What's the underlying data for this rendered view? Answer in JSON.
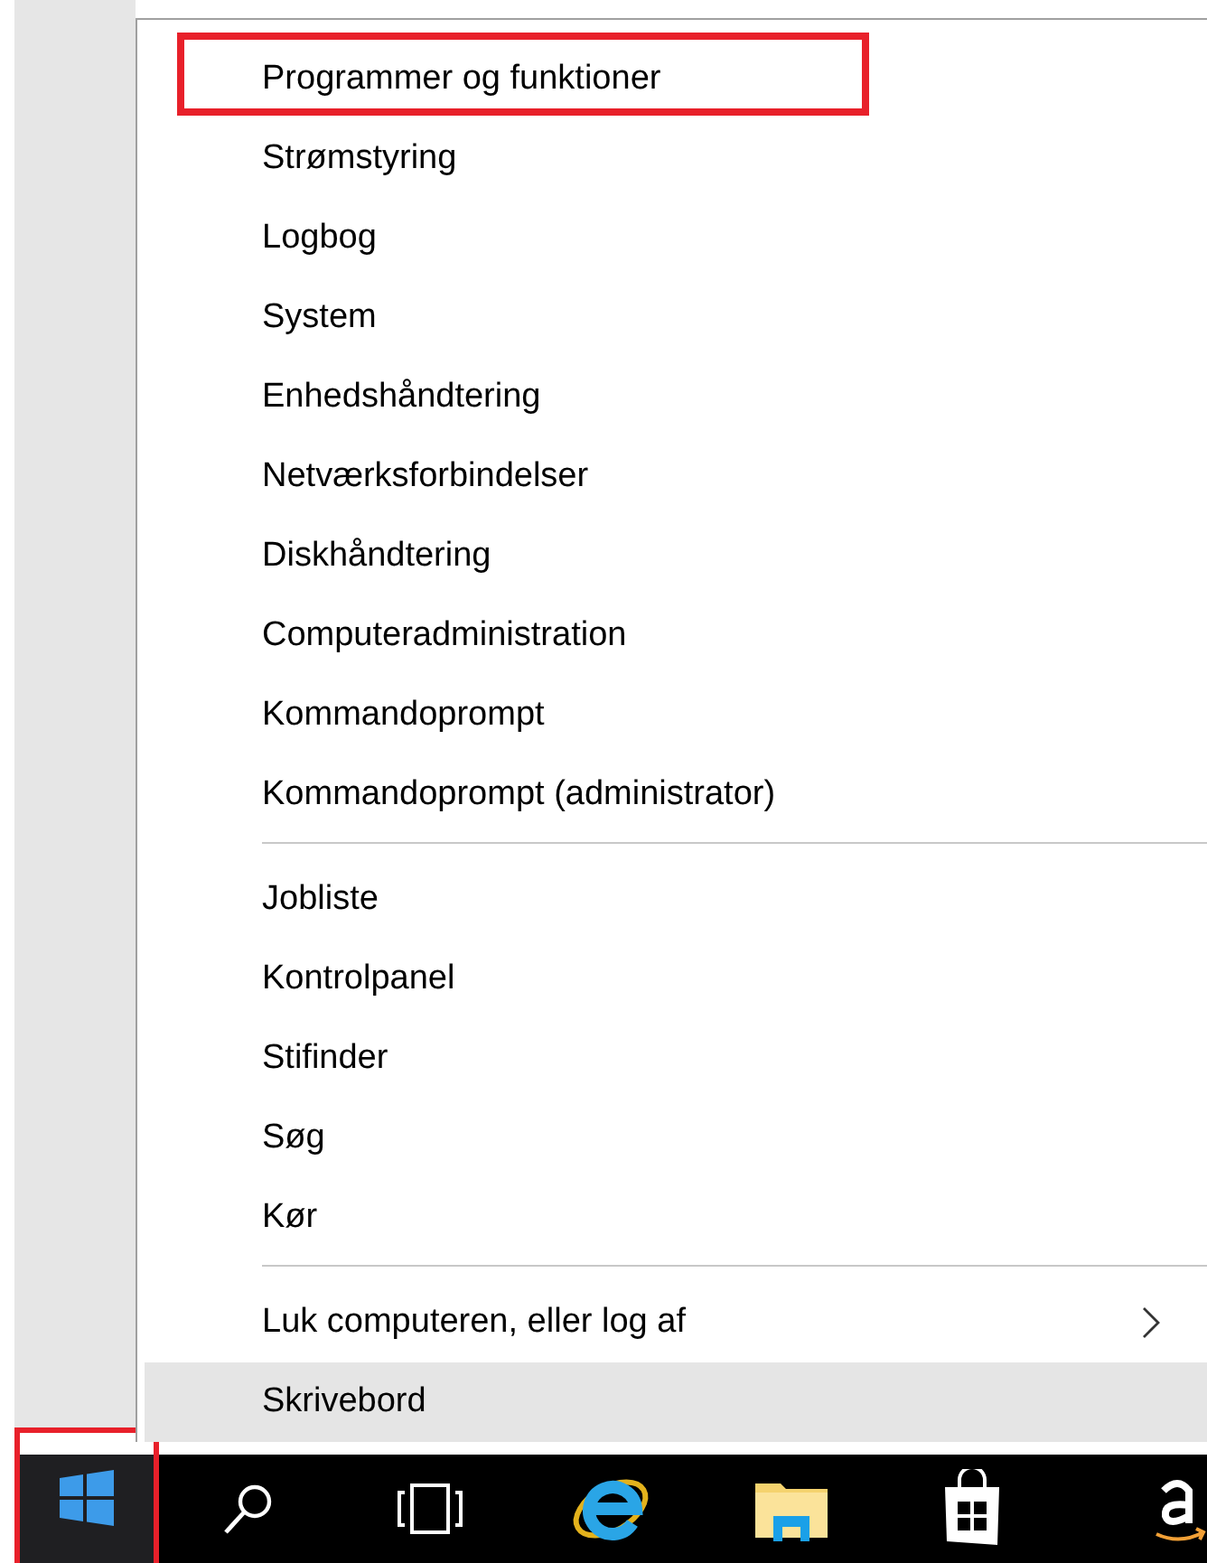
{
  "menu": {
    "groups": [
      {
        "items": [
          {
            "label": "Programmer og funktioner",
            "selected": false,
            "annotated": true
          },
          {
            "label": "Strømstyring",
            "selected": false,
            "annotated": false
          },
          {
            "label": "Logbog",
            "selected": false,
            "annotated": false
          },
          {
            "label": "System",
            "selected": false,
            "annotated": false
          },
          {
            "label": "Enhedshåndtering",
            "selected": false,
            "annotated": false
          },
          {
            "label": "Netværksforbindelser",
            "selected": false,
            "annotated": false
          },
          {
            "label": "Diskhåndtering",
            "selected": false,
            "annotated": false
          },
          {
            "label": "Computeradministration",
            "selected": false,
            "annotated": false
          },
          {
            "label": "Kommandoprompt",
            "selected": false,
            "annotated": false
          },
          {
            "label": "Kommandoprompt (administrator)",
            "selected": false,
            "annotated": false
          }
        ]
      },
      {
        "items": [
          {
            "label": "Jobliste",
            "selected": false,
            "annotated": false
          },
          {
            "label": "Kontrolpanel",
            "selected": false,
            "annotated": false
          },
          {
            "label": "Stifinder",
            "selected": false,
            "annotated": false
          },
          {
            "label": "Søg",
            "selected": false,
            "annotated": false
          },
          {
            "label": "Kør",
            "selected": false,
            "annotated": false
          }
        ]
      },
      {
        "items": [
          {
            "label": "Luk computeren, eller log af",
            "selected": false,
            "annotated": false,
            "kind": "submenu"
          },
          {
            "label": "Skrivebord",
            "selected": true,
            "annotated": false
          }
        ]
      }
    ]
  },
  "taskbar": {
    "start_button": {
      "annotated": true
    },
    "icons": [
      {
        "kind": "search"
      },
      {
        "kind": "taskview"
      },
      {
        "kind": "browser"
      },
      {
        "kind": "folder"
      },
      {
        "kind": "store"
      },
      {
        "kind": "amazon"
      }
    ]
  }
}
